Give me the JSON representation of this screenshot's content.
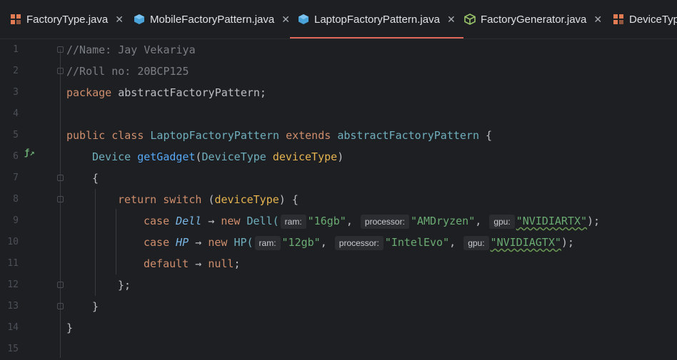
{
  "tabs": [
    {
      "label": "FactoryType.java",
      "icon": "java-class-icon",
      "active": false
    },
    {
      "label": "MobileFactoryPattern.java",
      "icon": "java-abstract-icon",
      "active": false
    },
    {
      "label": "LaptopFactoryPattern.java",
      "icon": "java-abstract-icon",
      "active": true
    },
    {
      "label": "FactoryGenerator.java",
      "icon": "java-interface-icon",
      "active": false
    },
    {
      "label": "DeviceTyp",
      "icon": "java-class-icon",
      "active": false
    }
  ],
  "close_glyph": "✕",
  "line_numbers": [
    "1",
    "2",
    "3",
    "4",
    "5",
    "6",
    "7",
    "8",
    "9",
    "10",
    "11",
    "12",
    "13",
    "14",
    "15"
  ],
  "code": {
    "l1": "//Name: Jay Vekariya",
    "l2": "//Roll no: 20BCP125",
    "l3_kw": "package",
    "l3_name": "abstractFactoryPattern;",
    "l5_kw1": "public",
    "l5_kw2": "class",
    "l5_name": "LaptopFactoryPattern",
    "l5_kw3": "extends",
    "l5_parent": "abstractFactoryPattern",
    "l5_brace": "{",
    "l6_type": "Device",
    "l6_fn": "getGadget",
    "l6_open": "(",
    "l6_ptype": "DeviceType",
    "l6_param": "deviceType",
    "l6_close": ")",
    "l7": "{",
    "l8_kw1": "return",
    "l8_kw2": "switch",
    "l8_open": "(",
    "l8_param": "deviceType",
    "l8_close": ") {",
    "l9_case": "case",
    "l9_const": "Dell",
    "l9_arrow": "→",
    "l9_new": "new",
    "l9_cls": "Dell(",
    "l9_h1": "ram:",
    "l9_v1": "\"16gb\"",
    "l9_h2": "processor:",
    "l9_v2": "\"AMDryzen\"",
    "l9_h3": "gpu:",
    "l9_v3": "\"NVIDIARTX\"",
    "l9_end": ");",
    "l10_case": "case",
    "l10_const": "HP",
    "l10_arrow": "→",
    "l10_new": "new",
    "l10_cls": "HP(",
    "l10_h1": "ram:",
    "l10_v1": "\"12gb\"",
    "l10_h2": "processor:",
    "l10_v2": "\"IntelEvo\"",
    "l10_h3": "gpu:",
    "l10_v3": "\"NVIDIAGTX\"",
    "l10_end": ");",
    "l11_kw": "default",
    "l11_arrow": "→",
    "l11_null": "null",
    "l11_end": ";",
    "l12": "};",
    "l13": "}",
    "l14": "}"
  },
  "colors": {
    "background": "#1e1f22",
    "keyword": "#cf8e6d",
    "comment": "#7a7e85",
    "string": "#6aab73",
    "function": "#56a8f5",
    "active_tab_underline": "#e0665a"
  }
}
